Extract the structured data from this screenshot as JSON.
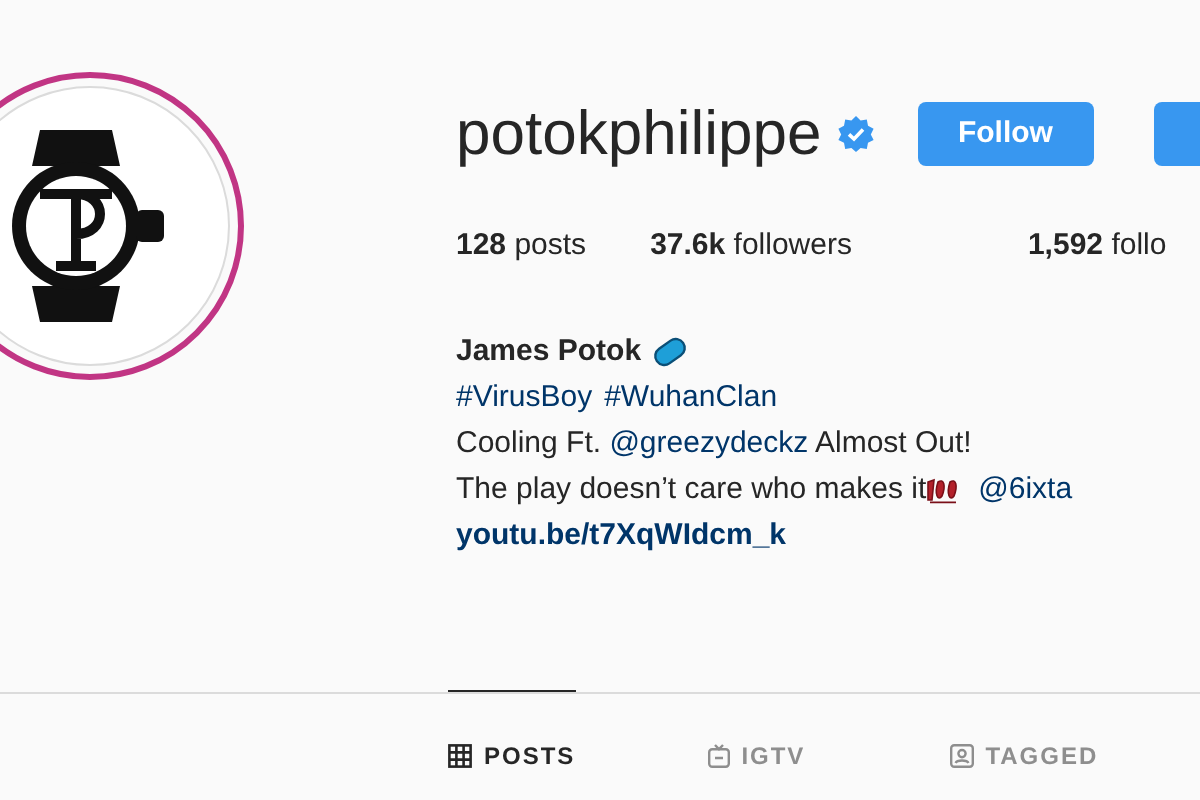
{
  "profile": {
    "username": "potokphilippe",
    "verified": true,
    "buttons": [
      {
        "label": "Follow",
        "kind": "primary"
      },
      {
        "kind": "cut"
      }
    ]
  },
  "stats": [
    {
      "count": "128",
      "label": "posts"
    },
    {
      "count": "37.6k",
      "label": "followers"
    },
    {
      "count": "1,592",
      "label": "follo"
    }
  ],
  "bio": {
    "name": "James Potok",
    "hashtags": [
      "#VirusBoy",
      "#WuhanClan"
    ],
    "lines": [
      [
        {
          "kind": "text",
          "text": "Cooling Ft. "
        },
        {
          "kind": "mention",
          "text": "@greezydeckz"
        },
        {
          "kind": "text",
          "text": " Almost Out!"
        }
      ],
      [
        {
          "kind": "text",
          "text": "The play doesn’t care who makes it"
        },
        {
          "kind": "emoji"
        },
        {
          "kind": "mention",
          "text": "@6ixta"
        }
      ]
    ],
    "website": "youtu.be/t7XqWIdcm_k"
  },
  "tabs": [
    {
      "label": "POSTS",
      "selected": true
    },
    {
      "label": "IGTV",
      "selected": false
    },
    {
      "label": "TAGGED",
      "selected": false
    }
  ]
}
